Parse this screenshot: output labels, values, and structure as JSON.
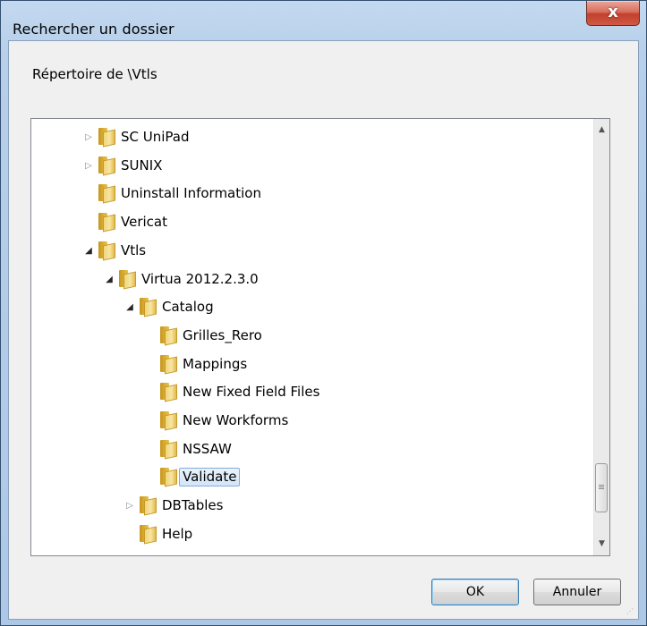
{
  "window": {
    "title": "Rechercher un dossier",
    "close_glyph": "x"
  },
  "dialog": {
    "description": "Répertoire de \\Vtls"
  },
  "tree": {
    "items": [
      {
        "label": "SC UniPad",
        "level": 0,
        "expander": "collapsed",
        "selected": false
      },
      {
        "label": "SUNIX",
        "level": 0,
        "expander": "collapsed",
        "selected": false
      },
      {
        "label": "Uninstall Information",
        "level": 0,
        "expander": "none",
        "selected": false
      },
      {
        "label": "Vericat",
        "level": 0,
        "expander": "none",
        "selected": false
      },
      {
        "label": "Vtls",
        "level": 0,
        "expander": "expanded",
        "selected": false
      },
      {
        "label": "Virtua 2012.2.3.0",
        "level": 1,
        "expander": "expanded",
        "selected": false
      },
      {
        "label": "Catalog",
        "level": 2,
        "expander": "expanded",
        "selected": false
      },
      {
        "label": "Grilles_Rero",
        "level": 3,
        "expander": "none",
        "selected": false
      },
      {
        "label": "Mappings",
        "level": 3,
        "expander": "none",
        "selected": false
      },
      {
        "label": "New Fixed Field Files",
        "level": 3,
        "expander": "none",
        "selected": false
      },
      {
        "label": "New Workforms",
        "level": 3,
        "expander": "none",
        "selected": false
      },
      {
        "label": "NSSAW",
        "level": 3,
        "expander": "none",
        "selected": false
      },
      {
        "label": "Validate",
        "level": 3,
        "expander": "none",
        "selected": true
      },
      {
        "label": "DBTables",
        "level": 2,
        "expander": "collapsed",
        "selected": false
      },
      {
        "label": "Help",
        "level": 2,
        "expander": "none",
        "selected": false
      }
    ]
  },
  "buttons": {
    "ok_label": "OK",
    "cancel_label": "Annuler"
  },
  "icons": {
    "folder": "folder-icon",
    "expander_collapsed": "triangle-right-icon",
    "expander_expanded": "triangle-down-icon"
  },
  "colors": {
    "selection_border": "#84acdd",
    "close_button": "#c2402c",
    "default_button_border": "#3c7fb1"
  }
}
